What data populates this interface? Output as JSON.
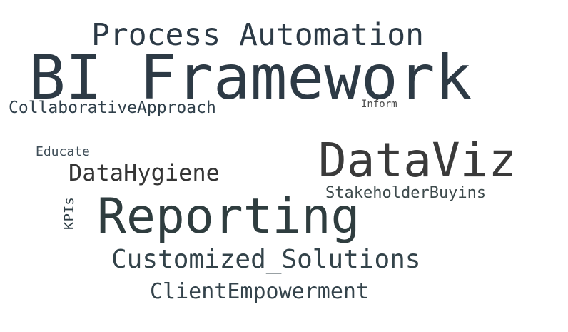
{
  "words": {
    "bi_framework": {
      "text": "BI Framework",
      "color": "#2d3a45"
    },
    "process_automation": {
      "text": "Process Automation",
      "color": "#2c3a46"
    },
    "dataviz": {
      "text": "DataViz",
      "color": "#3a3a3a"
    },
    "reporting": {
      "text": "Reporting",
      "color": "#2f3d3f"
    },
    "customized_solutions": {
      "text": "Customized_Solutions",
      "color": "#33434a"
    },
    "client_empowerment": {
      "text": "ClientEmpowerment",
      "color": "#34434b"
    },
    "data_hygiene": {
      "text": "DataHygiene",
      "color": "#353535"
    },
    "collaborative_approach": {
      "text": "CollaborativeApproach",
      "color": "#30404b"
    },
    "stakeholder_buyins": {
      "text": "StakeholderBuyins",
      "color": "#3d4a4c"
    },
    "educate": {
      "text": "Educate",
      "color": "#3f4e58"
    },
    "inform": {
      "text": "Inform",
      "color": "#4b4b4b"
    },
    "kpis": {
      "text": "KPIs",
      "color": "#2d3d44"
    }
  }
}
